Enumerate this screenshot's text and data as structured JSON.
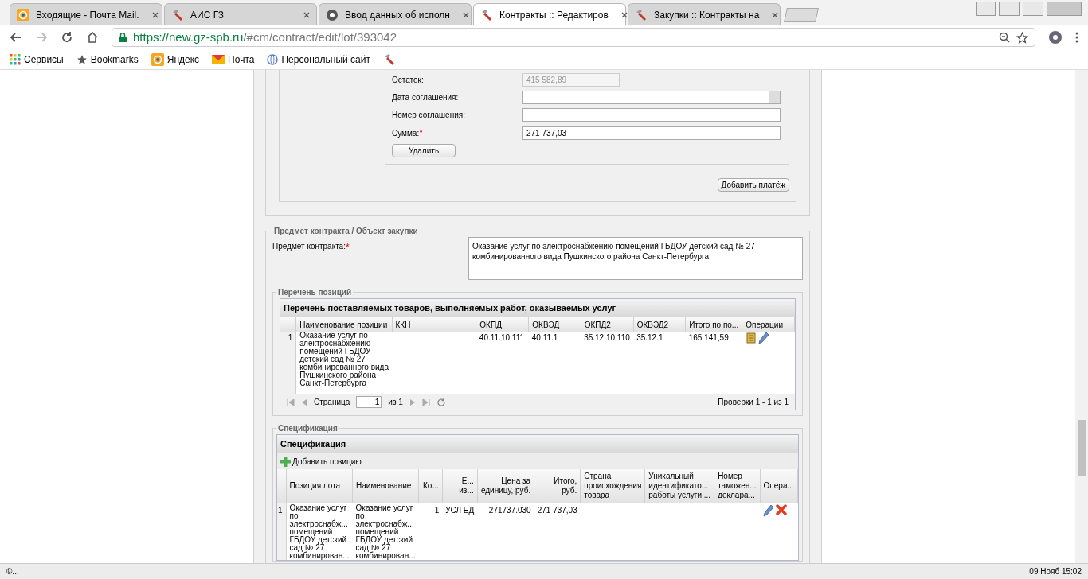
{
  "browser": {
    "tabs": [
      {
        "title": "Входящие - Почта Mail.",
        "kind": "mail",
        "selected": false
      },
      {
        "title": "АИС ГЗ",
        "kind": "tool",
        "selected": false
      },
      {
        "title": "Ввод данных об исполн",
        "kind": "chrome",
        "selected": false
      },
      {
        "title": "Контракты :: Редактиров",
        "kind": "tool",
        "selected": true
      },
      {
        "title": "Закупки :: Контракты на",
        "kind": "tool",
        "selected": false
      }
    ],
    "url": {
      "host": "https://new.gz-spb.ru",
      "path": "/#cm/contract/edit/lot/393042"
    },
    "bookmarks": [
      {
        "label": "Сервисы",
        "kind": "apps"
      },
      {
        "label": "Bookmarks",
        "kind": "star"
      },
      {
        "label": "Яндекс",
        "kind": "mail"
      },
      {
        "label": "Почта",
        "kind": "envelope"
      },
      {
        "label": "Персональный сайт",
        "kind": "globe"
      },
      {
        "kind": "tool"
      }
    ]
  },
  "payment": {
    "fields": [
      {
        "label": "Остаток:",
        "value": "415 582,89",
        "disabled": true,
        "kind": "text"
      },
      {
        "label": "Дата соглашения:",
        "disabled": false,
        "kind": "date"
      },
      {
        "label": "Номер соглашения:",
        "disabled": false,
        "kind": "text"
      },
      {
        "label": "Сумма:",
        "required_mark": "*",
        "value": "271 737,03",
        "disabled": false,
        "kind": "text"
      }
    ],
    "delete_button": "Удалить",
    "add_button": "Добавить платёж"
  },
  "subject": {
    "legend": "Предмет контракта / Объект закупки",
    "label": "Предмет контракта:",
    "required_mark": "*",
    "value": "Оказание услуг по электроснабжению помещений ГБДОУ детский сад № 27 комбинированного вида Пушкинского района Санкт-Петербурга"
  },
  "positions": {
    "legend": "Перечень позиций",
    "title": "Перечень поставляемых товаров, выполняемых работ, оказываемых услуг",
    "columns": [
      "Наименование позиции",
      "ККН",
      "ОКПД",
      "ОКВЭД",
      "ОКПД2",
      "ОКВЭД2",
      "Итого по по...",
      "Операции"
    ],
    "rows": [
      {
        "number": "1",
        "name": [
          "Оказание услуг по",
          "электроснабжению",
          "помещений ГБДОУ",
          "детский сад № 27",
          "комбинированного вида",
          "Пушкинского района",
          "Санкт-Петербурга"
        ],
        "okpd": "40.11.10.111",
        "okved": "40.11.1",
        "okpd2": "35.12.10.110",
        "okved2": "35.12.1",
        "total": "165 141,59"
      }
    ],
    "pager": {
      "page_label": "Страница",
      "page": "1",
      "of": "из 1",
      "summary": "Проверки 1 - 1 из 1"
    }
  },
  "spec": {
    "legend": "Спецификация",
    "title": "Спецификация",
    "add_button": "Добавить позицию",
    "columns": [
      [
        "Позиция лота"
      ],
      [
        "Наименование"
      ],
      [
        "Ко..."
      ],
      [
        "Е...",
        "из..."
      ],
      [
        "Цена за",
        "единицу, руб."
      ],
      [
        "Итого,",
        "руб."
      ],
      [
        "Страна",
        "происхождения",
        "товара"
      ],
      [
        "Уникальный",
        "идентификато...",
        "работы услуги ..."
      ],
      [
        "Номер",
        "таможен...",
        "деклара..."
      ],
      [
        "Опера..."
      ]
    ],
    "rows": [
      {
        "number": "1",
        "lot": [
          "Оказание услуг",
          "по",
          "электроснабж...",
          "помещений",
          "ГБДОУ детский",
          "сад № 27",
          "комбинирован..."
        ],
        "name": [
          "Оказание услуг",
          "по",
          "электроснабж...",
          "помещений",
          "ГБДОУ детский",
          "сад № 27",
          "комбинирован..."
        ],
        "qty": "1",
        "unit": "УСЛ ЕД",
        "price": "271737.030",
        "total": "271 737,03"
      }
    ]
  },
  "status_bar": {
    "left": "©...",
    "right": "09 Нояб 15:02"
  }
}
